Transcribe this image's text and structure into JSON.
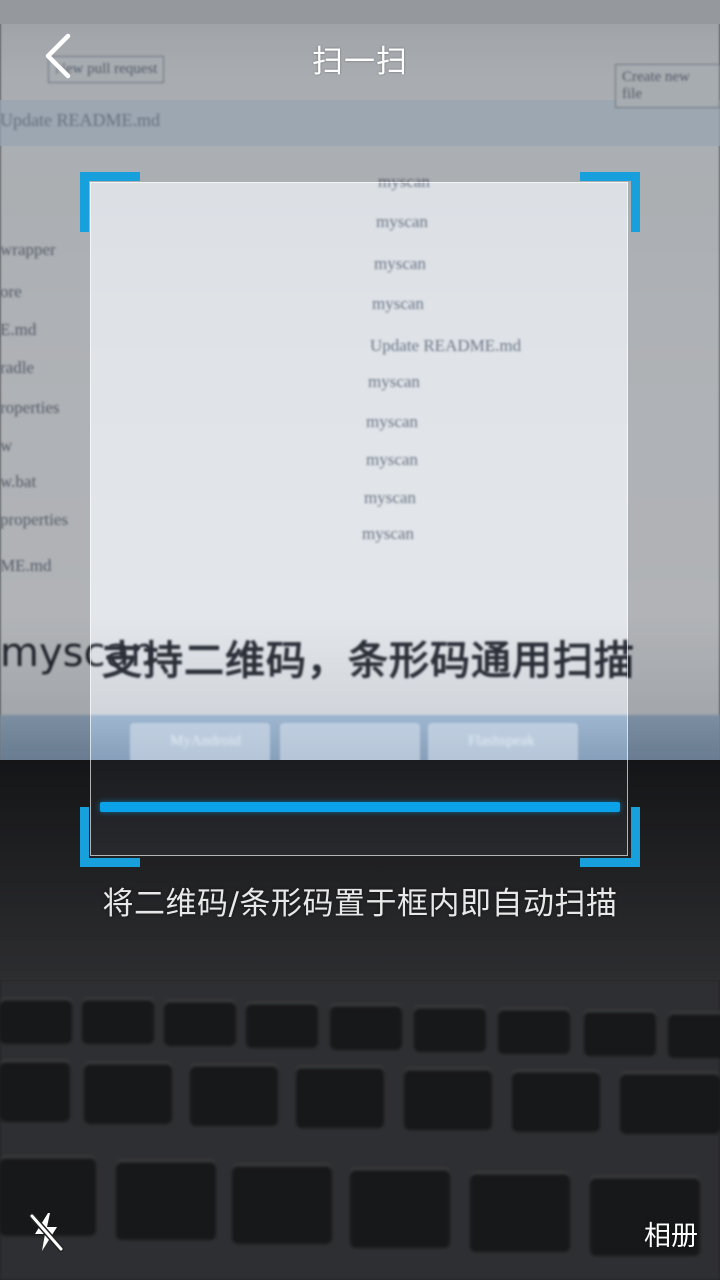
{
  "header": {
    "title": "扫一扫",
    "back_icon": "chevron-left-icon"
  },
  "scanner": {
    "frame_color": "#17a0dc",
    "scan_line_color": "#0ba2ea",
    "hint": "将二维码/条形码置于框内即自动扫描"
  },
  "bottom_bar": {
    "flash_icon": "flash-off-icon",
    "album_label": "相册"
  },
  "camera_view": {
    "file_list": [
      "myscan",
      "myscan",
      "myscan",
      "myscan",
      "Update README.md",
      "myscan",
      "myscan",
      "myscan",
      "myscan",
      "myscan"
    ],
    "left_list": [
      "wrapper",
      "ore",
      "E.md",
      "radle",
      "roperties",
      "w",
      "w.bat",
      "properties",
      "ME.md"
    ],
    "top_buttons": [
      "New pull request",
      "Create new file"
    ],
    "commit_banner": "Update README.md",
    "headline_prefix": "myscan",
    "headline": "支持二维码，条形码通用扫描",
    "taskbar_items": [
      "MyAndroid",
      "Flashspeak"
    ]
  }
}
